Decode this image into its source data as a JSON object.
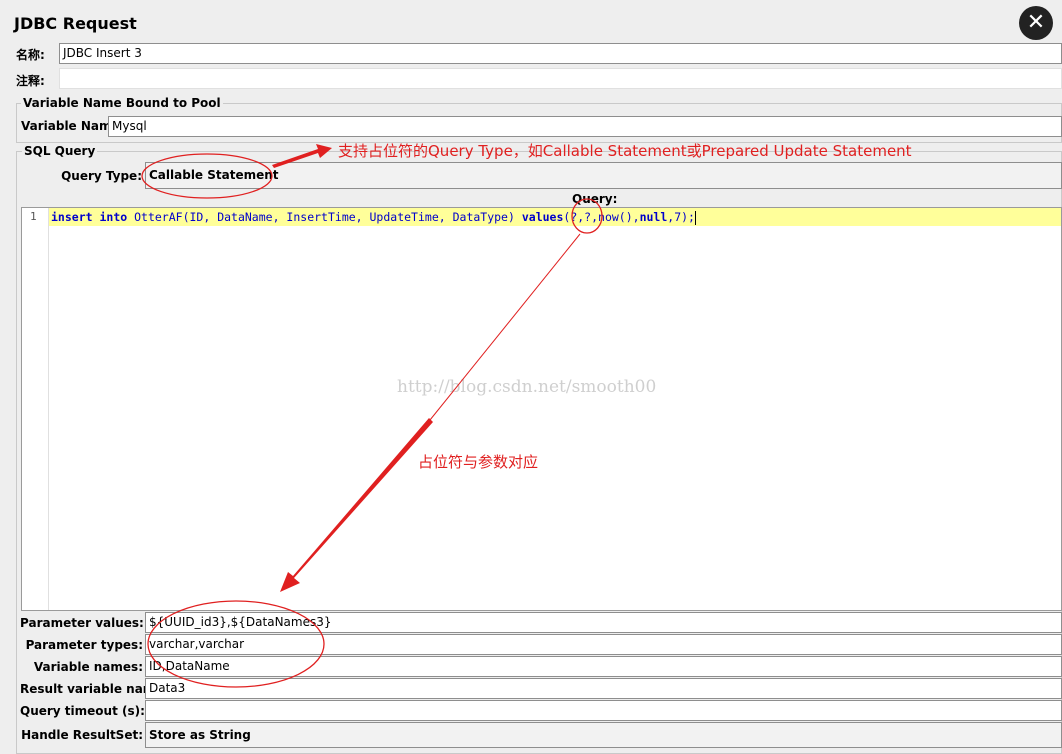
{
  "window": {
    "title": "JDBC Request"
  },
  "name_row": {
    "label": "名称:",
    "value": "JDBC Insert 3"
  },
  "comment_row": {
    "label": "注释:",
    "value": ""
  },
  "pool_group": {
    "title": "Variable Name Bound to Pool",
    "variable_label": "Variable Name:",
    "variable_value": "Mysql"
  },
  "sql_group": {
    "title": "SQL Query",
    "query_type_label": "Query Type:",
    "query_type_value": "Callable Statement",
    "query_label": "Query:",
    "editor": {
      "line_number": "1",
      "tokens": {
        "t1": "insert",
        "t2": " ",
        "t3": "into",
        "t4": " OtterAF(ID, DataName, InsertTime, UpdateTime, DataType) ",
        "t5": "values",
        "t6": "(?,?,",
        "t7": "now",
        "t8": "(),",
        "t9": "null",
        "t10": ",7);"
      }
    }
  },
  "params": {
    "values_label": "Parameter values:",
    "values_value": "${UUID_id3},${DataNames3}",
    "types_label": "Parameter types:",
    "types_value": "varchar,varchar",
    "names_label": "Variable names:",
    "names_value": "ID,DataName",
    "result_label": "Result variable name:",
    "result_value": "Data3",
    "timeout_label": "Query timeout (s):",
    "timeout_value": "",
    "handle_label": "Handle ResultSet:",
    "handle_value": "Store as String"
  },
  "annotations": {
    "placeholder_note": "支持占位符的Query Type，如Callable Statement或Prepared Update Statement",
    "mapping_note": "占位符与参数对应",
    "watermark": "http://blog.csdn.net/smooth00",
    "color": "#e02020"
  }
}
